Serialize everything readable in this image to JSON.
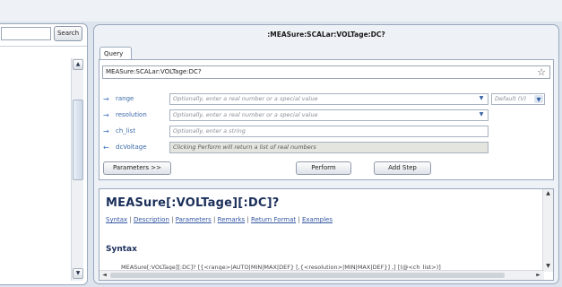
{
  "search": {
    "value": "",
    "button_label": "Search"
  },
  "panel": {
    "title": ":MEASure:SCALar:VOLTage:DC?"
  },
  "query_tab": {
    "label": "Query"
  },
  "command": {
    "text": "MEASure:SCALar:VOLTage:DC?"
  },
  "params": [
    {
      "name": "range",
      "placeholder": "Optionally, enter a real number or a special value"
    },
    {
      "name": "resolution",
      "placeholder": "Optionally, enter a real number or a special value"
    },
    {
      "name": "ch_list",
      "placeholder": "Optionally, enter a string"
    },
    {
      "name": "dcVoltage",
      "value": "Clicking Perform will return a list of real numbers"
    }
  ],
  "range_unit": {
    "value": "Default (V)"
  },
  "buttons": {
    "parameters": "Parameters >>",
    "perform": "Perform",
    "add_step": "Add Step"
  },
  "help": {
    "heading": "MEASure[:VOLTage][:DC]?",
    "links": [
      "Syntax",
      "Description",
      "Parameters",
      "Remarks",
      "Return Format",
      "Examples"
    ],
    "separator": "|",
    "syntax_heading": "Syntax",
    "syntax_text": "MEASure[:VOLTage][:DC]? [{<range>|AUTO|MIN|MAX|DEF} [,{<resolution>|MIN|MAX|DEF}] ,] [(@<ch_list>)]"
  },
  "icons": {
    "star": "☆",
    "arrow_in": "→",
    "arrow_out": "←",
    "dropdown": "▼",
    "scroll_up": "▲",
    "scroll_down": "▼",
    "scroll_left": "◄",
    "scroll_right": "►"
  },
  "colors": {
    "accent": "#3b6aa8",
    "heading": "#1b2f5a",
    "link": "#3557a3"
  }
}
